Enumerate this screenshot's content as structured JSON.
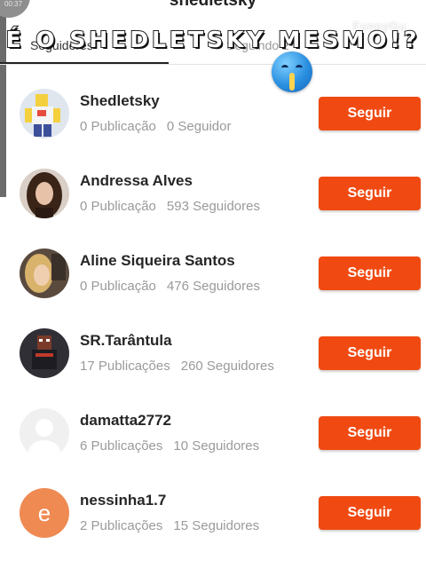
{
  "status": {
    "timer": "00:37"
  },
  "header": {
    "title": "shedletsky"
  },
  "tabs": [
    {
      "label": "Seguidores"
    },
    {
      "label": "Seguindo 2"
    }
  ],
  "watermark": "FunnyGu",
  "caption": "É O SHEDLETSKY MESMO!?",
  "overlay_emoji": "shushing-face-icon",
  "follow_label": "Seguir",
  "followers": [
    {
      "name": "Shedletsky",
      "posts": "0 Publicação",
      "followers": "0 Seguidor",
      "avatar": "roblox-avatar-shedletsky"
    },
    {
      "name": "Andressa Alves",
      "posts": "0 Publicação",
      "followers": "593 Seguidores",
      "avatar": "photo-andressa"
    },
    {
      "name": "Aline Siqueira Santos",
      "posts": "0 Publicação",
      "followers": "476 Seguidores",
      "avatar": "photo-aline"
    },
    {
      "name": "SR.Tarântula",
      "posts": "17 Publicações",
      "followers": "260 Seguidores",
      "avatar": "roblox-avatar-tarantula"
    },
    {
      "name": "damatta2772",
      "posts": "6 Publicações",
      "followers": "10 Seguidores",
      "avatar": "default-avatar"
    },
    {
      "name": "nessinha1.7",
      "posts": "2 Publicações",
      "followers": "15 Seguidores",
      "avatar": "letter-avatar",
      "avatar_letter": "e"
    }
  ],
  "colors": {
    "accent": "#f04a12",
    "text": "#262626",
    "muted": "#9a9a9a"
  }
}
